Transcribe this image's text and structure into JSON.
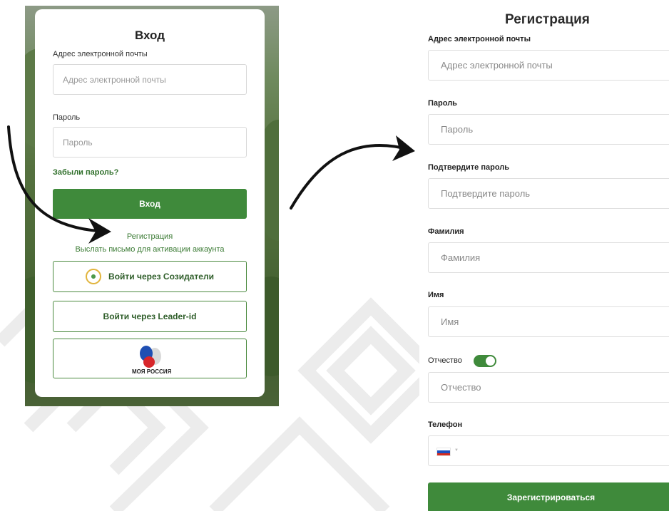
{
  "login": {
    "title": "Вход",
    "email_label": "Адрес электронной почты",
    "email_placeholder": "Адрес электронной почты",
    "password_label": "Пароль",
    "password_placeholder": "Пароль",
    "forgot_link": "Забыли пароль?",
    "login_button": "Вход",
    "register_link": "Регистрация",
    "activation_link": "Выслать письмо для активации аккаунта",
    "sozidateli_button": "Войти через Созидатели",
    "leaderid_button": "Войти через Leader-id",
    "myrussia_text": "МОЯ РОССИЯ"
  },
  "registration": {
    "title": "Регистрация",
    "email_label": "Адрес электронной почты",
    "email_placeholder": "Адрес электронной почты",
    "password_label": "Пароль",
    "password_placeholder": "Пароль",
    "confirm_label": "Подтвердите пароль",
    "confirm_placeholder": "Подтвердите пароль",
    "surname_label": "Фамилия",
    "surname_placeholder": "Фамилия",
    "name_label": "Имя",
    "name_placeholder": "Имя",
    "patronymic_label": "Отчество",
    "patronymic_placeholder": "Отчество",
    "patronymic_toggle_on": true,
    "phone_label": "Телефон",
    "phone_country_icon": "russia-flag-icon",
    "register_button": "Зарегистрироваться"
  },
  "colors": {
    "accent_green": "#3f8a3b",
    "link_green": "#2f6f2a",
    "pattern_gray": "#e8e8e8"
  }
}
